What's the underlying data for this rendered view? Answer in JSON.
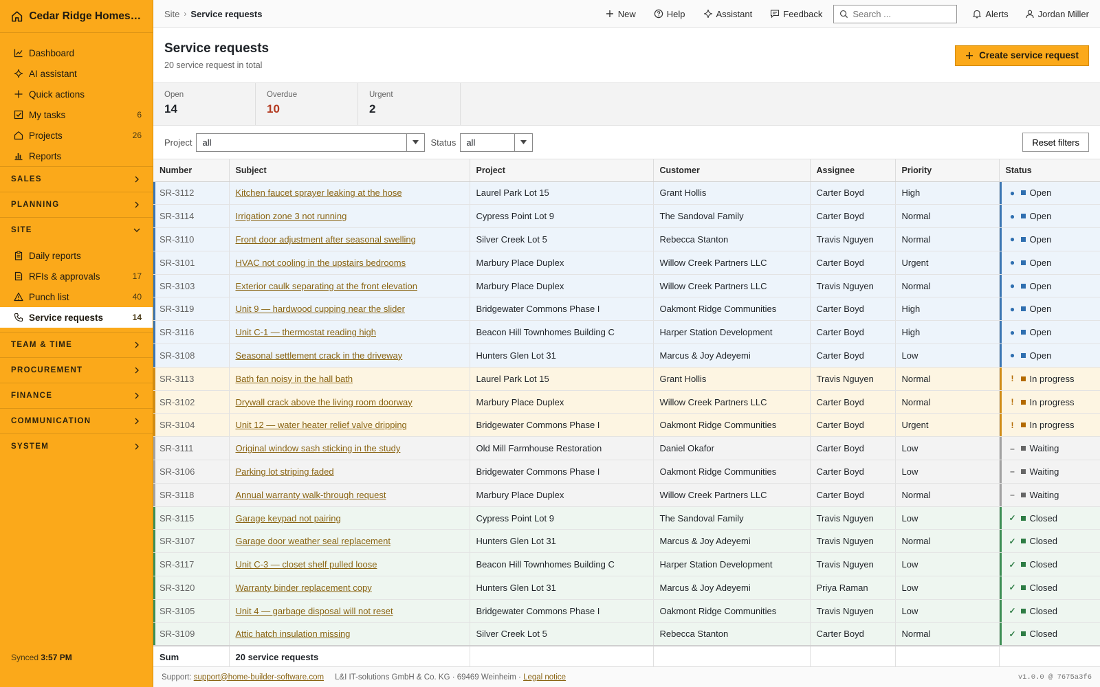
{
  "brand": {
    "name": "Cedar Ridge Homes L..."
  },
  "sidebar": {
    "primary": [
      {
        "label": "Dashboard",
        "icon": "chart-line-icon",
        "count": ""
      },
      {
        "label": "AI assistant",
        "icon": "sparkle-icon",
        "count": ""
      },
      {
        "label": "Quick actions",
        "icon": "plus-icon",
        "count": ""
      },
      {
        "label": "My tasks",
        "icon": "checkbox-icon",
        "count": "6"
      },
      {
        "label": "Projects",
        "icon": "house-icon",
        "count": "26"
      },
      {
        "label": "Reports",
        "icon": "bar-chart-icon",
        "count": ""
      }
    ],
    "sections": {
      "sales": "SALES",
      "planning": "PLANNING",
      "site": "SITE",
      "team": "TEAM & TIME",
      "procurement": "PROCUREMENT",
      "finance": "FINANCE",
      "communication": "COMMUNICATION",
      "system": "SYSTEM"
    },
    "site_items": [
      {
        "label": "Daily reports",
        "icon": "clipboard-icon",
        "count": ""
      },
      {
        "label": "RFIs & approvals",
        "icon": "document-icon",
        "count": "17"
      },
      {
        "label": "Punch list",
        "icon": "warning-icon",
        "count": "40"
      },
      {
        "label": "Service requests",
        "icon": "phone-icon",
        "count": "14"
      }
    ],
    "synced_label": "Synced",
    "synced_time": "3:57 PM"
  },
  "topbar": {
    "crumb_root": "Site",
    "crumb_current": "Service requests",
    "new_label": "New",
    "help_label": "Help",
    "assistant_label": "Assistant",
    "feedback_label": "Feedback",
    "search_placeholder": "Search ...",
    "alerts_label": "Alerts",
    "user_name": "Jordan Miller"
  },
  "header": {
    "title": "Service requests",
    "subtitle": "20 service request in total",
    "create_label": "Create service request"
  },
  "stats": {
    "open_label": "Open",
    "open_value": "14",
    "overdue_label": "Overdue",
    "overdue_value": "10",
    "urgent_label": "Urgent",
    "urgent_value": "2"
  },
  "filters": {
    "project_label": "Project",
    "project_value": "all",
    "status_label": "Status",
    "status_value": "all",
    "reset_label": "Reset filters"
  },
  "table": {
    "columns": [
      "Number",
      "Subject",
      "Project",
      "Customer",
      "Assignee",
      "Priority",
      "Status"
    ],
    "rows": [
      {
        "number": "SR-3112",
        "subject": "Kitchen faucet sprayer leaking at the hose",
        "project": "Laurel Park Lot 15",
        "customer": "Grant Hollis",
        "assignee": "Carter Boyd",
        "priority": "High",
        "status": "Open",
        "kind": "open"
      },
      {
        "number": "SR-3114",
        "subject": "Irrigation zone 3 not running",
        "project": "Cypress Point Lot 9",
        "customer": "The Sandoval Family",
        "assignee": "Carter Boyd",
        "priority": "Normal",
        "status": "Open",
        "kind": "open"
      },
      {
        "number": "SR-3110",
        "subject": "Front door adjustment after seasonal swelling",
        "project": "Silver Creek Lot 5",
        "customer": "Rebecca Stanton",
        "assignee": "Travis Nguyen",
        "priority": "Normal",
        "status": "Open",
        "kind": "open"
      },
      {
        "number": "SR-3101",
        "subject": "HVAC not cooling in the upstairs bedrooms",
        "project": "Marbury Place Duplex",
        "customer": "Willow Creek Partners LLC",
        "assignee": "Carter Boyd",
        "priority": "Urgent",
        "status": "Open",
        "kind": "open"
      },
      {
        "number": "SR-3103",
        "subject": "Exterior caulk separating at the front elevation",
        "project": "Marbury Place Duplex",
        "customer": "Willow Creek Partners LLC",
        "assignee": "Travis Nguyen",
        "priority": "Normal",
        "status": "Open",
        "kind": "open"
      },
      {
        "number": "SR-3119",
        "subject": "Unit 9 — hardwood cupping near the slider",
        "project": "Bridgewater Commons Phase I",
        "customer": "Oakmont Ridge Communities",
        "assignee": "Carter Boyd",
        "priority": "High",
        "status": "Open",
        "kind": "open"
      },
      {
        "number": "SR-3116",
        "subject": "Unit C-1 — thermostat reading high",
        "project": "Beacon Hill Townhomes Building C",
        "customer": "Harper Station Development",
        "assignee": "Carter Boyd",
        "priority": "High",
        "status": "Open",
        "kind": "open"
      },
      {
        "number": "SR-3108",
        "subject": "Seasonal settlement crack in the driveway",
        "project": "Hunters Glen Lot 31",
        "customer": "Marcus & Joy Adeyemi",
        "assignee": "Carter Boyd",
        "priority": "Low",
        "status": "Open",
        "kind": "open"
      },
      {
        "number": "SR-3113",
        "subject": "Bath fan noisy in the hall bath",
        "project": "Laurel Park Lot 15",
        "customer": "Grant Hollis",
        "assignee": "Travis Nguyen",
        "priority": "Normal",
        "status": "In progress",
        "kind": "prog"
      },
      {
        "number": "SR-3102",
        "subject": "Drywall crack above the living room doorway",
        "project": "Marbury Place Duplex",
        "customer": "Willow Creek Partners LLC",
        "assignee": "Carter Boyd",
        "priority": "Normal",
        "status": "In progress",
        "kind": "prog"
      },
      {
        "number": "SR-3104",
        "subject": "Unit 12 — water heater relief valve dripping",
        "project": "Bridgewater Commons Phase I",
        "customer": "Oakmont Ridge Communities",
        "assignee": "Carter Boyd",
        "priority": "Urgent",
        "status": "In progress",
        "kind": "prog"
      },
      {
        "number": "SR-3111",
        "subject": "Original window sash sticking in the study",
        "project": "Old Mill Farmhouse Restoration",
        "customer": "Daniel Okafor",
        "assignee": "Carter Boyd",
        "priority": "Low",
        "status": "Waiting",
        "kind": "wait"
      },
      {
        "number": "SR-3106",
        "subject": "Parking lot striping faded",
        "project": "Bridgewater Commons Phase I",
        "customer": "Oakmont Ridge Communities",
        "assignee": "Carter Boyd",
        "priority": "Low",
        "status": "Waiting",
        "kind": "wait"
      },
      {
        "number": "SR-3118",
        "subject": "Annual warranty walk-through request",
        "project": "Marbury Place Duplex",
        "customer": "Willow Creek Partners LLC",
        "assignee": "Carter Boyd",
        "priority": "Normal",
        "status": "Waiting",
        "kind": "wait"
      },
      {
        "number": "SR-3115",
        "subject": "Garage keypad not pairing",
        "project": "Cypress Point Lot 9",
        "customer": "The Sandoval Family",
        "assignee": "Travis Nguyen",
        "priority": "Low",
        "status": "Closed",
        "kind": "closed"
      },
      {
        "number": "SR-3107",
        "subject": "Garage door weather seal replacement",
        "project": "Hunters Glen Lot 31",
        "customer": "Marcus & Joy Adeyemi",
        "assignee": "Travis Nguyen",
        "priority": "Normal",
        "status": "Closed",
        "kind": "closed"
      },
      {
        "number": "SR-3117",
        "subject": "Unit C-3 — closet shelf pulled loose",
        "project": "Beacon Hill Townhomes Building C",
        "customer": "Harper Station Development",
        "assignee": "Travis Nguyen",
        "priority": "Low",
        "status": "Closed",
        "kind": "closed"
      },
      {
        "number": "SR-3120",
        "subject": "Warranty binder replacement copy",
        "project": "Hunters Glen Lot 31",
        "customer": "Marcus & Joy Adeyemi",
        "assignee": "Priya Raman",
        "priority": "Low",
        "status": "Closed",
        "kind": "closed"
      },
      {
        "number": "SR-3105",
        "subject": "Unit 4 — garbage disposal will not reset",
        "project": "Bridgewater Commons Phase I",
        "customer": "Oakmont Ridge Communities",
        "assignee": "Travis Nguyen",
        "priority": "Low",
        "status": "Closed",
        "kind": "closed"
      },
      {
        "number": "SR-3109",
        "subject": "Attic hatch insulation missing",
        "project": "Silver Creek Lot 5",
        "customer": "Rebecca Stanton",
        "assignee": "Carter Boyd",
        "priority": "Normal",
        "status": "Closed",
        "kind": "closed"
      }
    ],
    "sum_label": "Sum",
    "sum_value": "20 service requests"
  },
  "status_style": {
    "open": {
      "glyph": "●",
      "color": "#2f6fb0"
    },
    "prog": {
      "glyph": "!",
      "color": "#b36a00"
    },
    "wait": {
      "glyph": "–",
      "color": "#666666"
    },
    "closed": {
      "glyph": "✓",
      "color": "#2e7d45"
    }
  },
  "footer": {
    "support_label": "Support:",
    "support_email": "support@home-builder-software.com",
    "company": "L&I IT-solutions GmbH & Co. KG · 69469 Weinheim ·",
    "legal": "Legal notice",
    "version": "v1.0.0 @ 7675a3f6"
  },
  "colors": {
    "accent": "#fba91a",
    "link": "#8a6412",
    "overdue": "#b33a20"
  }
}
